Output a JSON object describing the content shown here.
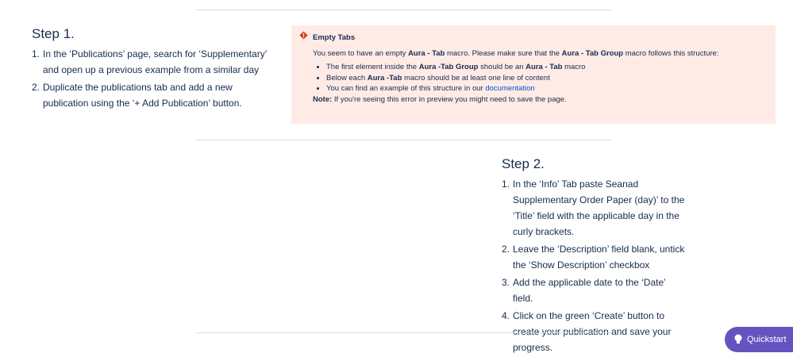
{
  "step1": {
    "title": "Step 1.",
    "items": [
      {
        "num": "1.",
        "text": "In the ‘Publications’ page, search for ‘Supplementary’ and open up a previous example from a similar day"
      },
      {
        "num": "2.",
        "text": "Duplicate the publications tab and add a new publication using the ‘+ Add Publication’ button."
      }
    ]
  },
  "alert": {
    "title": "Empty Tabs",
    "intro_pre": "You seem to have an empty ",
    "intro_b1": "Aura - Tab",
    "intro_mid": " macro. Please make sure that the ",
    "intro_b2": "Aura - Tab Group",
    "intro_post": " macro follows this structure:",
    "bullet1_pre": "The first element inside the ",
    "bullet1_b1": "Aura -Tab Group",
    "bullet1_mid": " should be an ",
    "bullet1_b2": "Aura - Tab",
    "bullet1_post": " macro",
    "bullet2_pre": "Below each ",
    "bullet2_b": "Aura -Tab",
    "bullet2_post": " macro should be at least one line of content",
    "bullet3_pre": "You can find an example of this structure in our ",
    "bullet3_link": "documentation",
    "note_label": "Note:",
    "note_text": " If you're seeing this error in preview you might need to save the page.",
    "icon": "error-icon",
    "colors": {
      "background": "#ffebe6",
      "icon": "#de350b",
      "link": "#0052cc"
    }
  },
  "step2": {
    "title": "Step 2.",
    "items": [
      {
        "num": "1.",
        "text": "In the ‘Info’ Tab paste Seanad Supplementary Order Paper (day)’ to the ‘Title’ field with the applicable day in the curly brackets."
      },
      {
        "num": "2.",
        "text": "Leave the ‘Description’ field blank, untick the ‘Show Description’ checkbox"
      },
      {
        "num": "3.",
        "text": "Add the applicable date to the ‘Date’ field."
      },
      {
        "num": "4.",
        "text": "Click on the green  ‘Create’ button to create your publication and save your progress."
      }
    ]
  },
  "quickstart": {
    "label": "Quickstart",
    "icon": "lightbulb-icon",
    "color": "#6554c0"
  }
}
